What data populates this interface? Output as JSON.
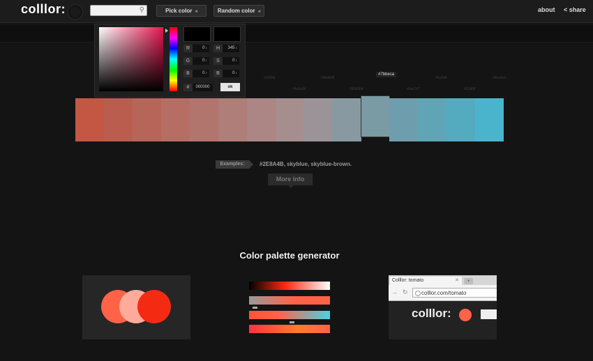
{
  "header": {
    "logo": "colllor:",
    "pick_color_label": "Pick color",
    "random_color_label": "Random color",
    "about_label": "about",
    "share_label": "share"
  },
  "picker": {
    "r": "0",
    "g": "0",
    "b": "0",
    "h": "345",
    "s": "0",
    "v": "0",
    "r_label": "R",
    "g_label": "G",
    "b_label": "B",
    "h_label": "H",
    "s_label": "S",
    "v_label": "B",
    "hash_label": "#",
    "hex": "000000",
    "ok_label": "ok",
    "gradient_color": "#e8154f"
  },
  "hex_labels": [
    "#c0898",
    "#4a3a3d",
    "#6ba5b8",
    "#80b5bd",
    "#7bbeca",
    "#6ac7d7",
    "#6c3d4",
    "#62d8ff",
    "#6ec9cd"
  ],
  "active_hex_label": "#7bbeca",
  "strip_colors": [
    "#c35744",
    "#ba5d4e",
    "#b86559",
    "#b66d63",
    "#b2756e",
    "#af7e79",
    "#ab8684",
    "#a68e8e",
    "#9c9399",
    "#8899a2",
    "#7a9aa4",
    "#6e9eae",
    "#5fa5b6",
    "#54abc0",
    "#4ab4cc"
  ],
  "examples": {
    "label": "Examples:",
    "links": "#2E8A4B, skyblue, skyblue-brown."
  },
  "more_info_label": "More info",
  "generator": {
    "title": "Color palette generator",
    "circle_colors": [
      "#ff6347",
      "#ffaa9a",
      "#f52a12"
    ],
    "browser": {
      "tab_title": "Colllor: tomato",
      "url": "colllor.com/tomato",
      "mini_logo": "colllor:"
    }
  }
}
